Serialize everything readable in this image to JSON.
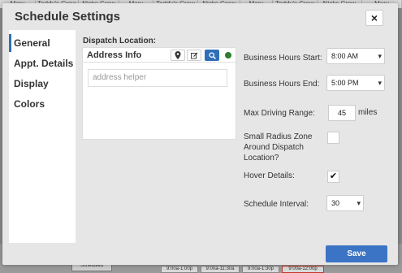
{
  "background": {
    "columns": [
      "Mary",
      "Teddy's Crew",
      "Nicks Crew",
      "Mary",
      "Teddy's Crew",
      "Nicks Crew",
      "Mary",
      "Teddy's Crew",
      "Nicks Crew",
      "Mary"
    ],
    "scheduled_label": "Scheduled",
    "slots": [
      "9:00a-1:00p",
      "9:00a-11:30a",
      "9:00a-1:30p",
      "9:00a-12:00p"
    ]
  },
  "dialog": {
    "title": "Schedule Settings",
    "close_label": "×",
    "nav": [
      {
        "label": "General",
        "active": true
      },
      {
        "label": "Appt. Details",
        "active": false
      },
      {
        "label": "Display",
        "active": false
      },
      {
        "label": "Colors",
        "active": false
      }
    ],
    "dispatch_label": "Dispatch Location:",
    "address": {
      "title": "Address Info",
      "placeholder": "address helper",
      "status_color": "#2e7d32"
    },
    "fields": {
      "hours_start_label": "Business Hours Start:",
      "hours_start_value": "8:00 AM",
      "hours_end_label": "Business Hours End:",
      "hours_end_value": "5:00 PM",
      "max_range_label": "Max Driving Range:",
      "max_range_value": "45",
      "max_range_unit": "miles",
      "small_radius_label": "Small Radius Zone Around Dispatch Location?",
      "small_radius_checked": false,
      "hover_label": "Hover Details:",
      "hover_checked": true,
      "interval_label": "Schedule Interval:",
      "interval_value": "30"
    },
    "save_label": "Save",
    "colors": {
      "accent": "#2f6fb8",
      "save": "#3b74c4"
    }
  }
}
